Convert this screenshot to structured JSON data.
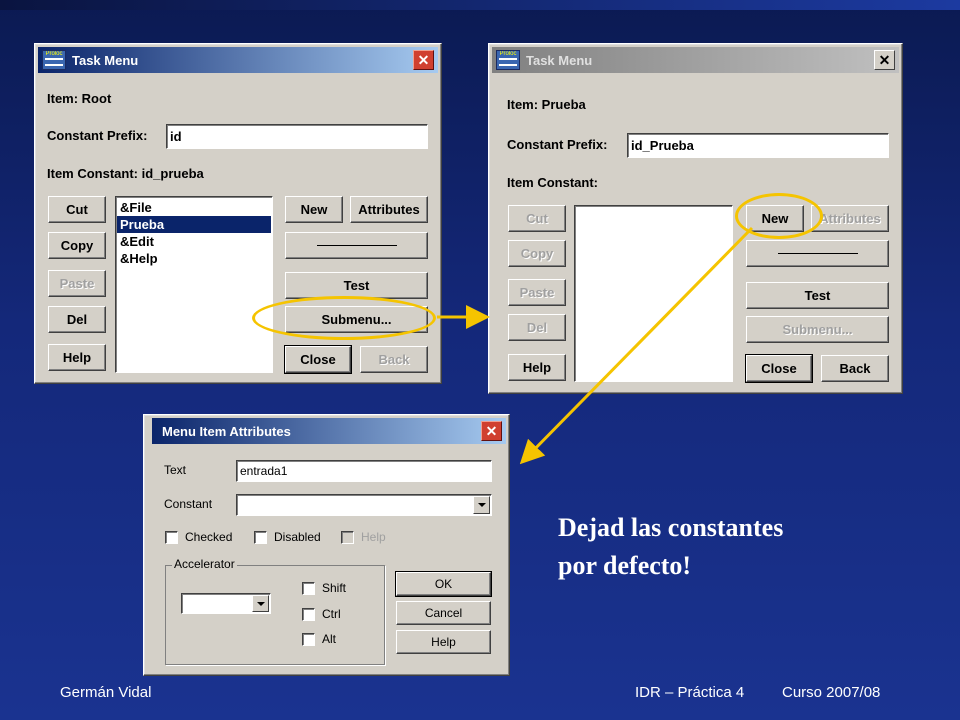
{
  "colors": {
    "slide_background": "#14287a",
    "highlight_ring": "#f5c400",
    "dialog_face": "#d4d0c8",
    "titlebar_active": "#0a246a",
    "titlebar_inactive": "#808080"
  },
  "dialog1": {
    "title": "Task Menu",
    "icon": "proloc-app-icon",
    "close_icon": "close-icon",
    "item_label": "Item: Root",
    "prefix_label": "Constant Prefix:",
    "prefix_value": "id",
    "constant_label": "Item Constant: id_prueba",
    "list_items": [
      "&File",
      "Prueba",
      "&Edit",
      "&Help"
    ],
    "selected_item": "Prueba",
    "buttons": {
      "cut": "Cut",
      "copy": "Copy",
      "paste": "Paste",
      "del": "Del",
      "help": "Help",
      "new": "New",
      "attributes": "Attributes",
      "test": "Test",
      "submenu": "Submenu...",
      "close": "Close",
      "back": "Back"
    }
  },
  "dialog2": {
    "title": "Task Menu",
    "icon": "proloc-app-icon",
    "close_icon": "close-icon",
    "item_label": "Item: Prueba",
    "prefix_label": "Constant Prefix:",
    "prefix_value": "id_Prueba",
    "constant_label": "Item Constant:",
    "buttons": {
      "cut": "Cut",
      "copy": "Copy",
      "paste": "Paste",
      "del": "Del",
      "help": "Help",
      "new": "New",
      "attributes": "Attributes",
      "test": "Test",
      "submenu": "Submenu...",
      "close": "Close",
      "back": "Back"
    }
  },
  "dialog3": {
    "title": "Menu Item Attributes",
    "close_icon": "close-icon",
    "text_label": "Text",
    "text_value": "entrada1",
    "constant_label": "Constant",
    "constant_value": "",
    "checkboxes": {
      "checked": "Checked",
      "disabled": "Disabled",
      "help": "Help"
    },
    "accelerator_label": "Accelerator",
    "modifiers": {
      "shift": "Shift",
      "ctrl": "Ctrl",
      "alt": "Alt"
    },
    "buttons": {
      "ok": "OK",
      "cancel": "Cancel",
      "help": "Help"
    }
  },
  "note": {
    "line1": "Dejad las constantes",
    "line2": "por defecto!"
  },
  "footer": {
    "author": "Germán Vidal",
    "course": "IDR – Práctica 4",
    "year": "Curso 2007/08"
  }
}
